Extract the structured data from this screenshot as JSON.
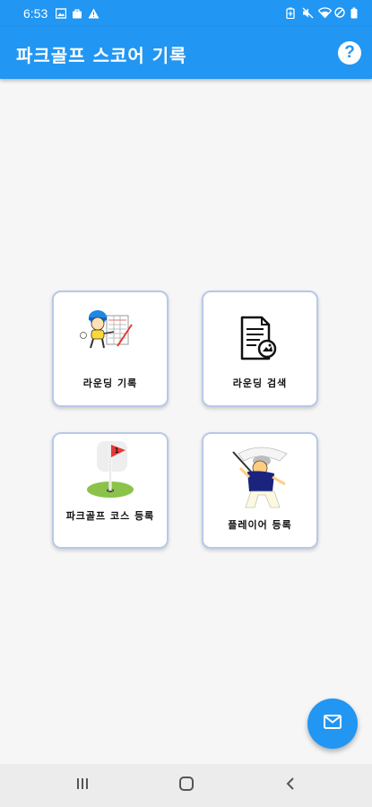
{
  "status_bar": {
    "time": "6:53",
    "left_icons": [
      "image-icon",
      "bag-icon",
      "warning-icon"
    ],
    "right_icons": [
      "battery-saver-icon",
      "mute-icon",
      "wifi-icon",
      "dnd-icon",
      "battery-icon"
    ]
  },
  "app_bar": {
    "title": "파크골프 스코어 기록",
    "help_icon": "?"
  },
  "menu": {
    "items": [
      {
        "label": "라운딩 기록",
        "icon": "golfer-scorecard-illustration"
      },
      {
        "label": "라운딩 검색",
        "icon": "document-search-icon"
      },
      {
        "label": "파크골프 코스 등록",
        "icon": "golf-flag-illustration"
      },
      {
        "label": "플레이어 등록",
        "icon": "golfer-swing-illustration"
      }
    ]
  },
  "fab": {
    "icon": "mail-icon"
  },
  "nav_bar": {
    "buttons": [
      "recent-apps",
      "home",
      "back"
    ]
  },
  "colors": {
    "primary": "#2196f3",
    "background": "#f6f6f6",
    "card_border": "#b8c8e8"
  }
}
